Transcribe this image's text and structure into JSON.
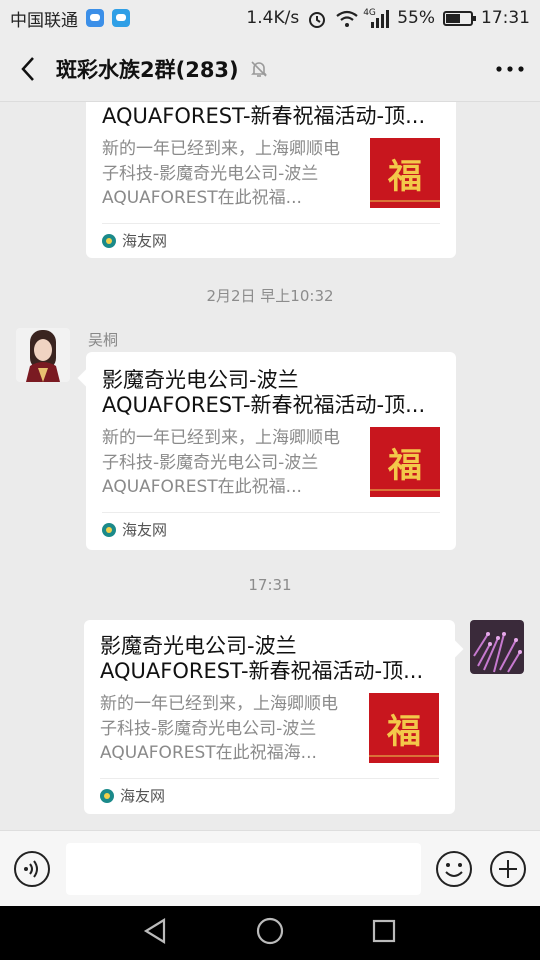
{
  "statusbar": {
    "carrier": "中国联通",
    "speed": "1.4K/s",
    "network_tag": "4G",
    "battery": "55%",
    "battery_level": 0.55,
    "time": "17:31"
  },
  "header": {
    "title": "斑彩水族2群(283)"
  },
  "messages": [
    {
      "title": "AQUAFOREST-新春祝福活动-顶...",
      "desc": "新的一年已经到来，上海卿顺电子科技-影魔奇光电公司-波兰AQUAFOREST在此祝福...",
      "source": "海友网",
      "thumb_char": "福"
    },
    {
      "timestamp": "2月2日 早上10:32",
      "sender": "吴桐",
      "title": "影魔奇光电公司-波兰AQUAFOREST-新春祝福活动-顶...",
      "desc": "新的一年已经到来，上海卿顺电子科技-影魔奇光电公司-波兰AQUAFOREST在此祝福...",
      "source": "海友网",
      "thumb_char": "福"
    },
    {
      "timestamp": "17:31",
      "title": "影魔奇光电公司-波兰AQUAFOREST-新春祝福活动-顶...",
      "desc": "新的一年已经到来，上海卿顺电子科技-影魔奇光电公司-波兰AQUAFOREST在此祝福海...",
      "source": "海友网",
      "thumb_char": "福"
    }
  ],
  "colors": {
    "thumb_red": "#c8161e",
    "chat_bg": "#ebebeb"
  }
}
